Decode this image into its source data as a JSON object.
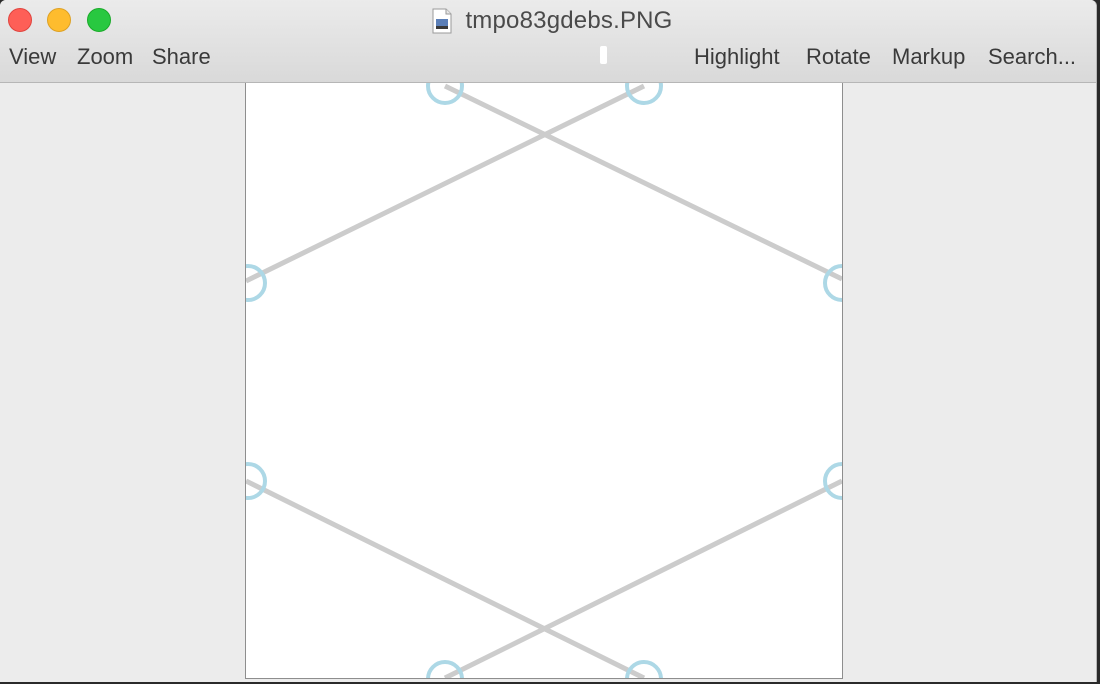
{
  "window": {
    "title": "tmpo83gdebs.PNG"
  },
  "toolbar": {
    "view": "View",
    "zoom": "Zoom",
    "share": "Share",
    "highlight": "Highlight",
    "rotate": "Rotate",
    "markup": "Markup",
    "search": "Search..."
  },
  "colors": {
    "line": "#cccccc",
    "circle": "#add8e6",
    "close": "#fe5f57",
    "minimize": "#febc2e",
    "maximize": "#28c840"
  },
  "icons": {
    "file": "png-file-icon"
  }
}
